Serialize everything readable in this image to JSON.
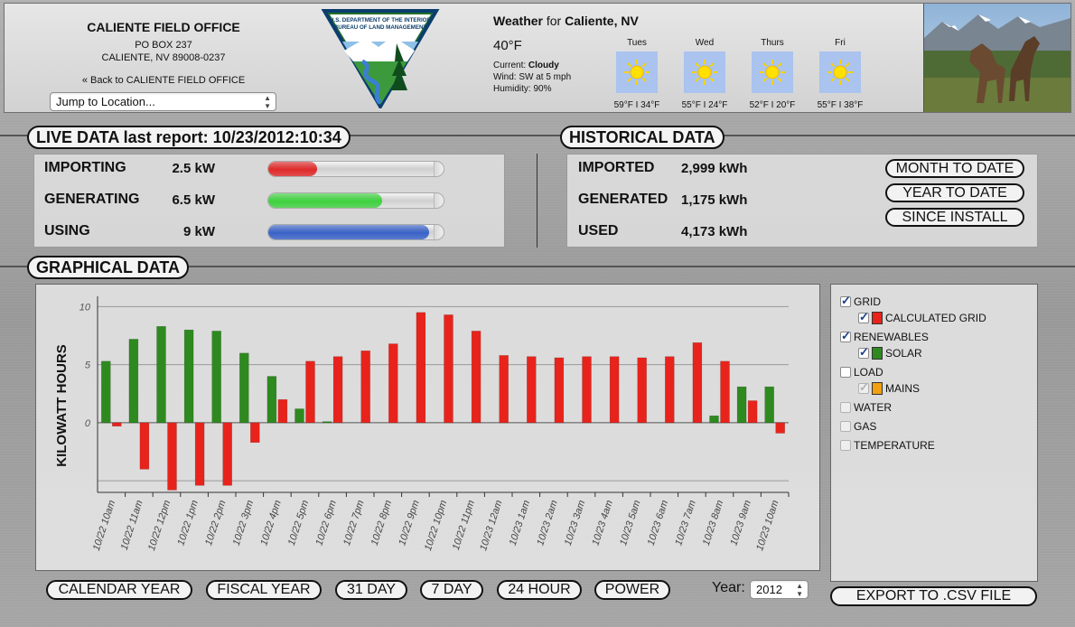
{
  "office": {
    "name": "CALIENTE FIELD OFFICE",
    "address1": "PO BOX 237",
    "address2": "CALIENTE, NV 89008-0237",
    "back_link": "« Back to CALIENTE FIELD OFFICE",
    "jump_placeholder": "Jump to Location..."
  },
  "logo": {
    "line1": "U.S. DEPARTMENT OF THE INTERIOR",
    "line2": "BUREAU OF LAND MANAGEMENT"
  },
  "weather": {
    "prefix": "Weather",
    "for": " for ",
    "location": "Caliente, NV",
    "temp": "40°F",
    "current_label": "Current: ",
    "current_value": "Cloudy",
    "wind": "Wind: SW at 5 mph",
    "humidity": "Humidity: 90%",
    "forecast": [
      {
        "day": "Tues",
        "temps": "59°F I 34°F",
        "icon": "sun-icon"
      },
      {
        "day": "Wed",
        "temps": "55°F I 24°F",
        "icon": "sun-icon"
      },
      {
        "day": "Thurs",
        "temps": "52°F I 20°F",
        "icon": "sun-icon"
      },
      {
        "day": "Fri",
        "temps": "55°F I 38°F",
        "icon": "sun-icon"
      }
    ]
  },
  "live": {
    "title": "LIVE DATA last report: 10/23/2012:10:34",
    "rows": [
      {
        "label": "IMPORTING",
        "value": "2.5 kW",
        "level": 0.28,
        "color": "#e02a2a"
      },
      {
        "label": "GENERATING",
        "value": "6.5 kW",
        "level": 0.65,
        "color": "#3fd23f"
      },
      {
        "label": "USING",
        "value": "9 kW",
        "level": 0.92,
        "color": "#3a63c8"
      }
    ]
  },
  "historical": {
    "title": "HISTORICAL DATA",
    "rows": [
      {
        "label": "IMPORTED",
        "value": "2,999 kWh"
      },
      {
        "label": "GENERATED",
        "value": "1,175 kWh"
      },
      {
        "label": "USED",
        "value": "4,173 kWh"
      }
    ],
    "buttons": [
      "MONTH TO DATE",
      "YEAR TO DATE",
      "SINCE INSTALL"
    ]
  },
  "graphical": {
    "title": "GRAPHICAL DATA",
    "range_buttons": [
      "CALENDAR YEAR",
      "FISCAL YEAR",
      "31 DAY",
      "7 DAY",
      "24 HOUR",
      "POWER"
    ],
    "year_label": "Year:",
    "year_value": "2012",
    "export_label": "EXPORT TO .CSV FILE"
  },
  "legend": [
    {
      "label": "GRID",
      "checked": true,
      "indent": false,
      "swatch": null,
      "disabled": false
    },
    {
      "label": "CALCULATED GRID",
      "checked": true,
      "indent": true,
      "swatch": "#e8231c",
      "disabled": false
    },
    {
      "label": "RENEWABLES",
      "checked": true,
      "indent": false,
      "swatch": null,
      "disabled": false
    },
    {
      "label": "SOLAR",
      "checked": true,
      "indent": true,
      "swatch": "#2e8a1f",
      "disabled": false
    },
    {
      "label": "LOAD",
      "checked": false,
      "indent": false,
      "swatch": null,
      "disabled": false
    },
    {
      "label": "MAINS",
      "checked": true,
      "indent": true,
      "swatch": "#f0a010",
      "disabled": true
    },
    {
      "label": "WATER",
      "checked": false,
      "indent": false,
      "swatch": null,
      "disabled": true
    },
    {
      "label": "GAS",
      "checked": false,
      "indent": false,
      "swatch": null,
      "disabled": true
    },
    {
      "label": "TEMPERATURE",
      "checked": false,
      "indent": false,
      "swatch": null,
      "disabled": true
    }
  ],
  "chart_data": {
    "type": "bar",
    "ylabel": "KILOWATT HOURS",
    "xlabel": "",
    "ylim": [
      -6,
      10.5
    ],
    "yticks": [
      0,
      5,
      10
    ],
    "grid": true,
    "categories": [
      "10/22 10am",
      "10/22 11am",
      "10/22 12pm",
      "10/22 1pm",
      "10/22 2pm",
      "10/22 3pm",
      "10/22 4pm",
      "10/22 5pm",
      "10/22 6pm",
      "10/22 7pm",
      "10/22 8pm",
      "10/22 9pm",
      "10/22 10pm",
      "10/22 11pm",
      "10/23 12am",
      "10/23 1am",
      "10/23 2am",
      "10/23 3am",
      "10/23 4am",
      "10/23 5am",
      "10/23 6am",
      "10/23 7am",
      "10/23 8am",
      "10/23 9am",
      "10/23 10am"
    ],
    "series": [
      {
        "name": "SOLAR",
        "color": "#2e8a1f",
        "values": [
          5.3,
          7.2,
          8.3,
          8.0,
          7.9,
          6.0,
          4.0,
          1.2,
          0.1,
          0,
          0,
          0,
          0,
          0,
          0,
          0,
          0,
          0,
          0,
          0,
          0,
          0,
          0.6,
          3.1,
          3.1
        ]
      },
      {
        "name": "CALCULATED GRID",
        "color": "#e8231c",
        "values": [
          -0.3,
          -4.0,
          -5.8,
          -5.4,
          -5.4,
          -1.7,
          2.0,
          5.3,
          5.7,
          6.2,
          6.8,
          9.5,
          9.3,
          7.9,
          5.8,
          5.7,
          5.6,
          5.7,
          5.7,
          5.6,
          5.7,
          6.9,
          5.3,
          1.9,
          -0.9
        ]
      }
    ]
  }
}
